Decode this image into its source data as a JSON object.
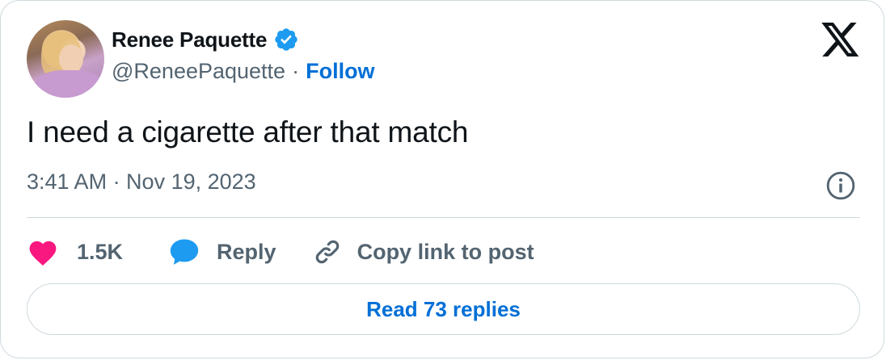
{
  "author": {
    "display_name": "Renee Paquette",
    "handle": "@ReneePaquette",
    "separator": "·",
    "follow_label": "Follow",
    "avatar": "profile-photo"
  },
  "post": {
    "text": "I need a cigarette after that match",
    "timestamp": "3:41 AM · Nov 19, 2023"
  },
  "actions": {
    "like_count": "1.5K",
    "reply_label": "Reply",
    "copy_label": "Copy link to post"
  },
  "footer": {
    "read_replies_label": "Read 73 replies"
  },
  "icons": {
    "verified": "verified-badge-icon",
    "brand": "x-logo-icon",
    "info": "info-icon",
    "like": "heart-icon",
    "reply": "speech-bubble-icon",
    "copy": "link-icon"
  },
  "colors": {
    "text_primary": "#0f1419",
    "text_secondary": "#536471",
    "link": "#006fd6",
    "verified": "#1d9bf0",
    "like": "#f91880",
    "reply": "#1d9bf0",
    "border": "#cfd9de"
  }
}
